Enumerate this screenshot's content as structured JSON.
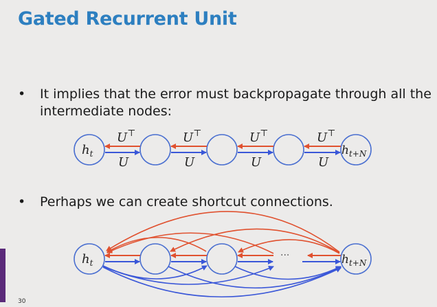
{
  "slide": {
    "title": "Gated Recurrent Unit",
    "bullets": [
      {
        "marker": "•",
        "text": "It implies that the error must backpropagate through all the intermediate nodes:"
      },
      {
        "marker": "•",
        "text": "Perhaps we can create shortcut connections."
      }
    ],
    "page_number": "30"
  },
  "diagram1": {
    "start_label": "h",
    "start_sub": "t",
    "end_label": "h",
    "end_sub": "t+N",
    "forward_label": "U",
    "backward_label": "U",
    "backward_sup": "⊤"
  },
  "diagram2": {
    "start_label": "h",
    "start_sub": "t",
    "end_label": "h",
    "end_sub": "t+N",
    "ellipsis": "···"
  },
  "colors": {
    "title": "#2d7fc0",
    "node_stroke": "#4a6fd0",
    "forward_arrow": "#3a57d8",
    "backward_arrow": "#e0512f",
    "side_bar": "#5b2a7a"
  }
}
